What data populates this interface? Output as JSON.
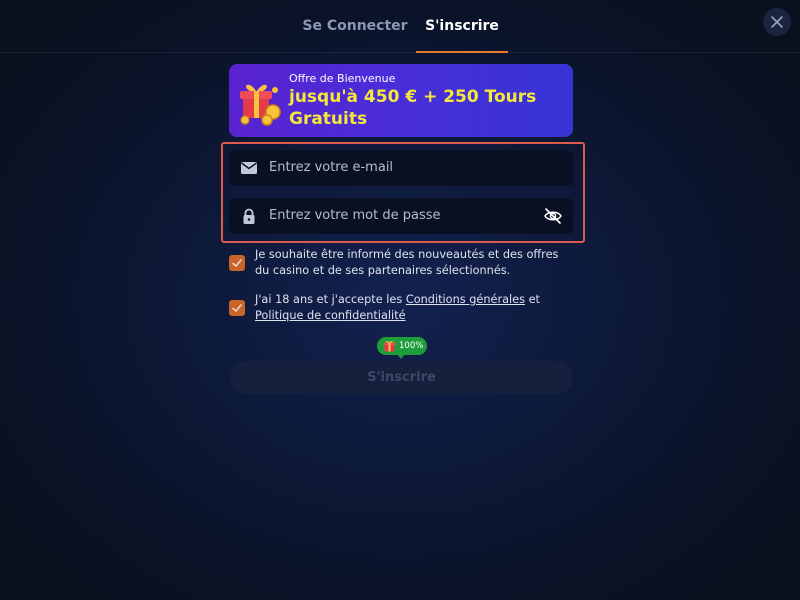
{
  "tabs": [
    {
      "label": "Se Connecter",
      "active": false
    },
    {
      "label": "S'inscrire",
      "active": true
    }
  ],
  "banner": {
    "small": "Offre de Bienvenue",
    "big": "jusqu'à 450 € + 250 Tours Gratuits"
  },
  "form": {
    "email_placeholder": "Entrez votre e-mail",
    "password_placeholder": "Entrez votre mot de passe"
  },
  "consents": {
    "newsletter": {
      "checked": true,
      "text": "Je souhaite être informé des nouveautés et des offres du casino et de ses partenaires sélectionnés."
    },
    "terms": {
      "checked": true,
      "prefix": "J'ai 18 ans et j'accepte les",
      "terms_link": "Conditions générales",
      "joiner": "et",
      "privacy_link": "Politique de confidentialité"
    }
  },
  "progress": {
    "label": "100%",
    "value": 100
  },
  "submit_label": "S'inscrire",
  "colors": {
    "accent": "#e8792f",
    "banner_text": "#f4e83a",
    "checkbox": "#c8642a",
    "highlight_border": "#dd5a4e",
    "badge": "#1e9e3b"
  }
}
